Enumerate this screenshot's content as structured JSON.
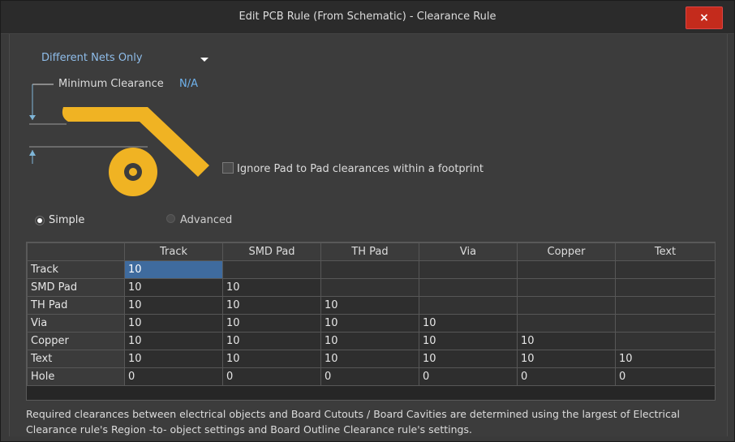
{
  "window": {
    "title": "Edit PCB Rule (From Schematic) - Clearance Rule",
    "close_label": "×"
  },
  "rule": {
    "scope": "Different Nets Only",
    "min_clearance_label": "Minimum Clearance",
    "min_clearance_value": "N/A",
    "ignore_pad_label": "Ignore Pad to Pad clearances within a footprint",
    "ignore_pad_checked": false
  },
  "mode": {
    "simple_label": "Simple",
    "advanced_label": "Advanced",
    "selected": "Simple"
  },
  "grid": {
    "columns": [
      "Track",
      "SMD Pad",
      "TH Pad",
      "Via",
      "Copper",
      "Text"
    ],
    "rows": [
      {
        "label": "Track",
        "values": [
          "10",
          "",
          "",
          "",
          "",
          ""
        ]
      },
      {
        "label": "SMD Pad",
        "values": [
          "10",
          "10",
          "",
          "",
          "",
          ""
        ]
      },
      {
        "label": "TH Pad",
        "values": [
          "10",
          "10",
          "10",
          "",
          "",
          ""
        ]
      },
      {
        "label": "Via",
        "values": [
          "10",
          "10",
          "10",
          "10",
          "",
          ""
        ]
      },
      {
        "label": "Copper",
        "values": [
          "10",
          "10",
          "10",
          "10",
          "10",
          ""
        ]
      },
      {
        "label": "Text",
        "values": [
          "10",
          "10",
          "10",
          "10",
          "10",
          "10"
        ]
      },
      {
        "label": "Hole",
        "values": [
          "0",
          "0",
          "0",
          "0",
          "0",
          "0"
        ]
      }
    ]
  },
  "note": "Required clearances between electrical objects and Board Cutouts / Board Cavities are determined using the largest of Electrical Clearance rule's Region -to- object settings and Board Outline Clearance rule's settings.",
  "colors": {
    "accent": "#6fb2ec",
    "copper": "#f0b323",
    "selection": "#3f6b9e",
    "close": "#c42b1c"
  }
}
